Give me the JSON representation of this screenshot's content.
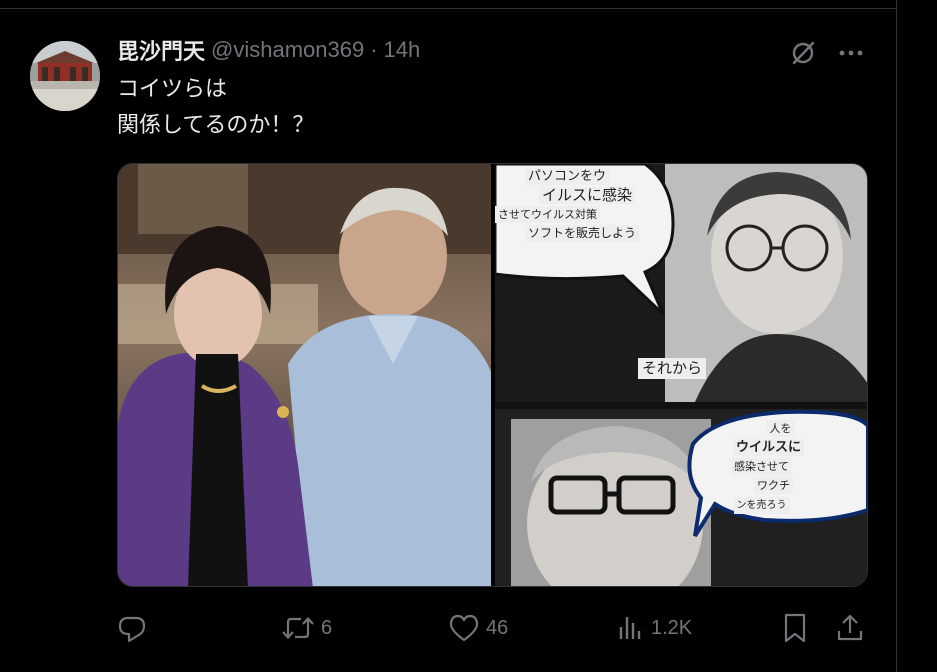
{
  "tweet": {
    "display_name": "毘沙門天",
    "handle": "@vishamon369",
    "separator": "·",
    "time": "14h",
    "text_line1": "コイツらは",
    "text_line2": "関係してるのか！？"
  },
  "media": {
    "right_captions": {
      "bubble1_line1": "パソコンをウ",
      "bubble1_line2": "イルスに感染",
      "bubble1_line3": "させてウイルス対策",
      "bubble1_line4": "ソフトを販売しよう",
      "mid": "それから",
      "bubble2_line1": "人を",
      "bubble2_line2": "ウイルスに",
      "bubble2_line3": "感染させて",
      "bubble2_line4": "ワクチ",
      "bubble2_line5": "ンを売ろう"
    }
  },
  "actions": {
    "reply_count": "",
    "retweet_count": "6",
    "like_count": "46",
    "views_count": "1.2K"
  },
  "icons": {
    "more": "more-icon",
    "grok": "grok-icon",
    "reply": "reply-icon",
    "retweet": "retweet-icon",
    "like": "like-icon",
    "views": "views-icon",
    "bookmark": "bookmark-icon",
    "share": "share-icon"
  },
  "colors": {
    "background": "#000000",
    "text": "#e7e9ea",
    "muted": "#71767b",
    "border": "#2f3336"
  }
}
